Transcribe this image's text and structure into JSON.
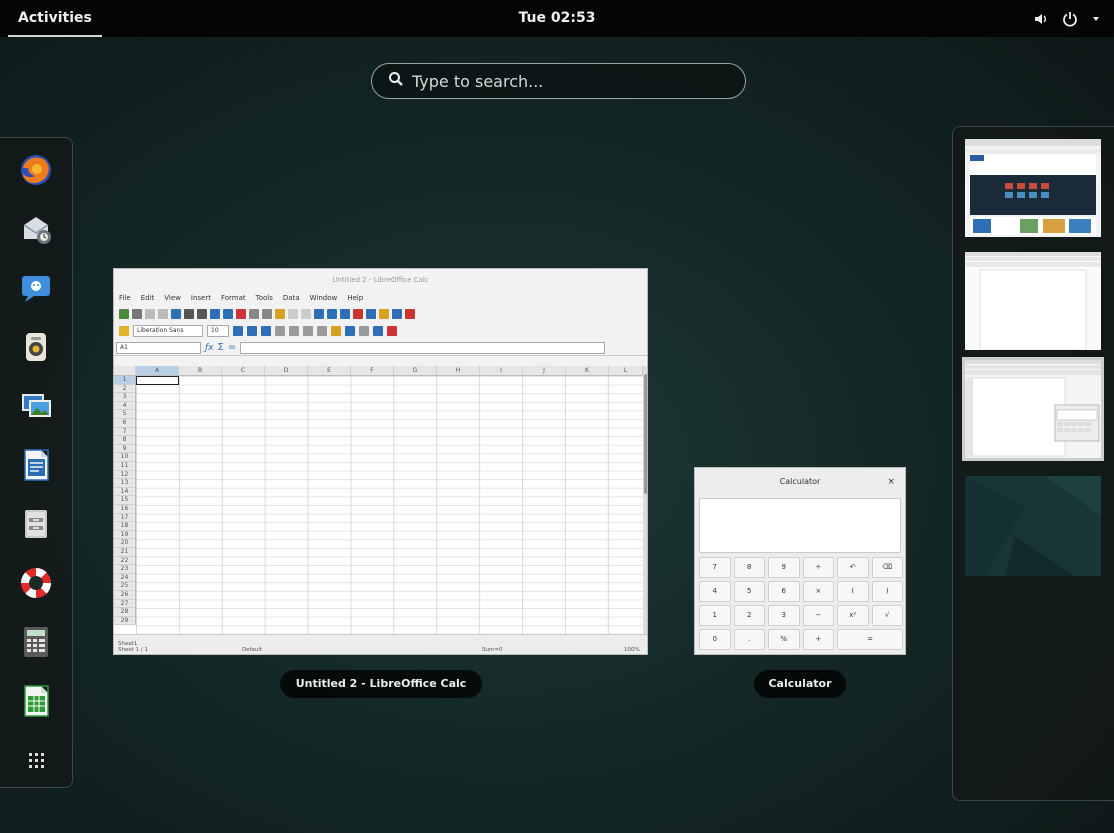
{
  "topbar": {
    "activities_label": "Activities",
    "clock": "Tue 02:53",
    "icons": [
      "volume-icon",
      "power-icon",
      "chevron-down-icon"
    ]
  },
  "search": {
    "placeholder": "Type to search..."
  },
  "dash": {
    "items": [
      {
        "name": "firefox",
        "icon": "firefox-icon"
      },
      {
        "name": "evolution",
        "icon": "evolution-icon"
      },
      {
        "name": "empathy",
        "icon": "chat-icon"
      },
      {
        "name": "rhythmbox",
        "icon": "rhythmbox-icon"
      },
      {
        "name": "shotwell",
        "icon": "photos-icon"
      },
      {
        "name": "writer",
        "icon": "libreoffice-writer-icon"
      },
      {
        "name": "files",
        "icon": "files-icon"
      },
      {
        "name": "help",
        "icon": "help-icon"
      },
      {
        "name": "calculator",
        "icon": "calculator-icon"
      },
      {
        "name": "calc",
        "icon": "libreoffice-calc-icon"
      },
      {
        "name": "show-apps",
        "icon": "app-grid-icon"
      }
    ]
  },
  "windows": {
    "calc": {
      "title": "Untitled 2 - LibreOffice Calc",
      "caption": "Untitled 2 - LibreOffice Calc",
      "menu": [
        "File",
        "Edit",
        "View",
        "Insert",
        "Format",
        "Tools",
        "Data",
        "Window",
        "Help"
      ],
      "font_name": "Liberation Sans",
      "font_size": "10",
      "cell_ref": "A1",
      "columns": [
        "A",
        "B",
        "C",
        "D",
        "E",
        "F",
        "G",
        "H",
        "I",
        "J",
        "K",
        "L"
      ],
      "rows": [
        "1",
        "2",
        "3",
        "4",
        "5",
        "6",
        "7",
        "8",
        "9",
        "10",
        "11",
        "12",
        "13",
        "14",
        "15",
        "16",
        "17",
        "18",
        "19",
        "20",
        "21",
        "22",
        "23",
        "24",
        "25",
        "26",
        "27",
        "28",
        "29"
      ],
      "sheet_tab": "Sheet1",
      "status_sheet": "Sheet 1 / 1",
      "status_style": "Default",
      "status_sum": "Sum=0",
      "status_zoom": "100%"
    },
    "calculator": {
      "title": "Calculator",
      "caption": "Calculator",
      "close": "×",
      "keys": [
        "7",
        "8",
        "9",
        "÷",
        "↶",
        "⌫",
        "4",
        "5",
        "6",
        "×",
        "(",
        ")",
        "1",
        "2",
        "3",
        "−",
        "x²",
        "√",
        "0",
        ".",
        "%",
        "+",
        "="
      ]
    }
  }
}
